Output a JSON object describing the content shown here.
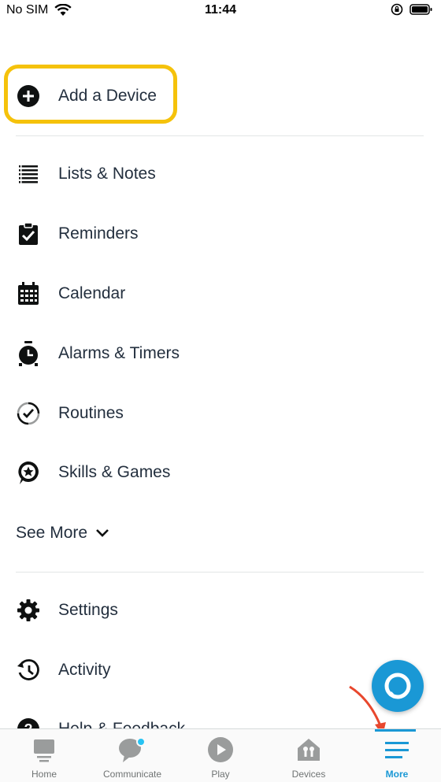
{
  "status_bar": {
    "carrier": "No SIM",
    "time": "11:44"
  },
  "menu": {
    "add_device": "Add a Device",
    "items": [
      {
        "label": "Lists & Notes",
        "icon": "list-icon"
      },
      {
        "label": "Reminders",
        "icon": "clipboard-check-icon"
      },
      {
        "label": "Calendar",
        "icon": "calendar-icon"
      },
      {
        "label": "Alarms & Timers",
        "icon": "alarm-clock-icon"
      },
      {
        "label": "Routines",
        "icon": "routines-icon"
      },
      {
        "label": "Skills & Games",
        "icon": "skills-icon"
      }
    ],
    "see_more": "See More",
    "bottom_items": [
      {
        "label": "Settings",
        "icon": "gear-icon"
      },
      {
        "label": "Activity",
        "icon": "history-icon"
      },
      {
        "label": "Help & Feedback",
        "icon": "help-icon"
      }
    ]
  },
  "bottom_nav": {
    "items": [
      {
        "label": "Home",
        "icon": "home-icon"
      },
      {
        "label": "Communicate",
        "icon": "chat-icon"
      },
      {
        "label": "Play",
        "icon": "play-icon"
      },
      {
        "label": "Devices",
        "icon": "devices-icon"
      },
      {
        "label": "More",
        "icon": "menu-icon",
        "active": true
      }
    ]
  },
  "colors": {
    "accent": "#1a98d5",
    "highlight": "#f5c20b",
    "annotation_arrow": "#e8472d"
  }
}
